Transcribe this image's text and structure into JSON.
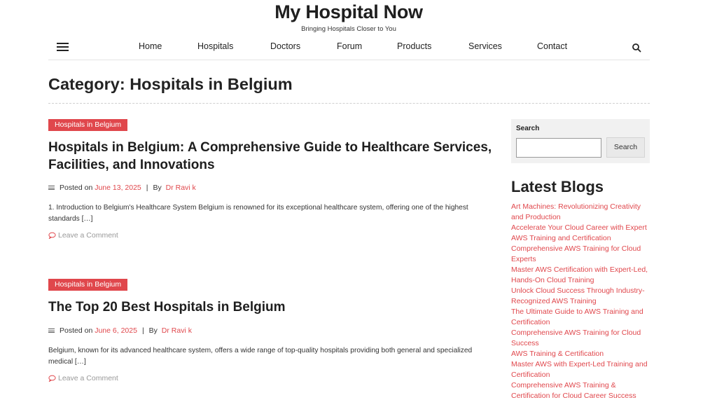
{
  "header": {
    "title": "My Hospital Now",
    "tagline": "Bringing Hospitals Closer to You"
  },
  "nav": {
    "items": [
      "Home",
      "Hospitals",
      "Doctors",
      "Forum",
      "Products",
      "Services",
      "Contact"
    ],
    "menu_icon": "hamburger-menu-icon",
    "search_icon": "search-icon"
  },
  "page": {
    "heading": "Category: Hospitals in Belgium"
  },
  "posts": [
    {
      "category": "Hospitals in Belgium",
      "title": "Hospitals in Belgium: A Comprehensive Guide to Healthcare Services, Facilities, and Innovations",
      "posted_label": "Posted on",
      "date": "June 13, 2025",
      "by_label": "By",
      "author": "Dr Ravi k",
      "excerpt": "1. Introduction to Belgium's Healthcare System Belgium is renowned for its exceptional healthcare system, offering one of the highest standards […]",
      "comment_label": "Leave a Comment"
    },
    {
      "category": "Hospitals in Belgium",
      "title": "The Top 20 Best Hospitals in Belgium",
      "posted_label": "Posted on",
      "date": "June 6, 2025",
      "by_label": "By",
      "author": "Dr Ravi k",
      "excerpt": "Belgium, known for its advanced healthcare system, offers a wide range of top-quality hospitals providing both general and specialized medical […]",
      "comment_label": "Leave a Comment"
    }
  ],
  "sidebar": {
    "search": {
      "label": "Search",
      "value": "",
      "button": "Search"
    },
    "latest_heading": "Latest Blogs",
    "latest": [
      "Art Machines: Revolutionizing Creativity and Production",
      "Accelerate Your Cloud Career with Expert AWS Training and Certification",
      "Comprehensive AWS Training for Cloud Experts",
      "Master AWS Certification with Expert-Led, Hands-On Cloud Training",
      "Unlock Cloud Success Through Industry-Recognized AWS Training",
      "The Ultimate Guide to AWS Training and Certification",
      "Comprehensive AWS Training for Cloud Success",
      "AWS Training & Certification",
      "Master AWS with Expert-Led Training and Certification",
      "Comprehensive AWS Training & Certification for Cloud Career Success"
    ]
  },
  "colors": {
    "accent": "#e0474c",
    "text": "#222222",
    "muted": "#999999",
    "widget_bg": "#f1f1f1"
  }
}
